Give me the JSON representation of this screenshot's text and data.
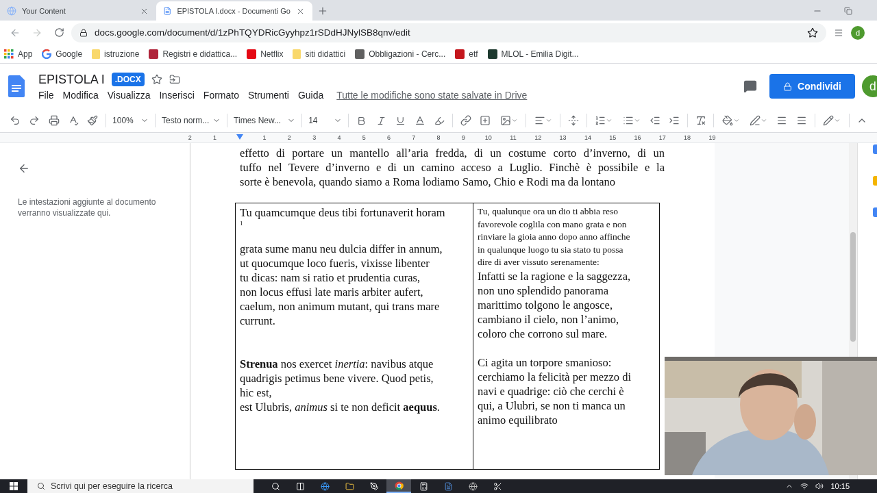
{
  "browser": {
    "tabs": [
      {
        "title": "Your Content",
        "selected": false
      },
      {
        "title": "EPISTOLA I.docx - Documenti Go",
        "selected": true
      }
    ],
    "url": "docs.google.com/document/d/1zPhTQYDRicGyyhpz1rSDdHJNylSB8qnv/edit",
    "profile": "d",
    "bookmarks": [
      {
        "label": "App",
        "kind": "apps"
      },
      {
        "label": "Google",
        "kind": "google"
      },
      {
        "label": "istruzione",
        "kind": "folder"
      },
      {
        "label": "Registri e didattica...",
        "kind": "site",
        "color": "#b0243a"
      },
      {
        "label": "Netflix",
        "kind": "site",
        "color": "#e50914"
      },
      {
        "label": "siti didattici",
        "kind": "folder"
      },
      {
        "label": "Obbligazioni - Cerc...",
        "kind": "site",
        "color": "#606060"
      },
      {
        "label": "etf",
        "kind": "site",
        "color": "#c4161c"
      },
      {
        "label": "MLOL - Emilia Digit...",
        "kind": "site",
        "color": "#1e3a2f"
      }
    ]
  },
  "docs": {
    "title": "EPISTOLA I",
    "badge": ".DOCX",
    "menu": [
      "File",
      "Modifica",
      "Visualizza",
      "Inserisci",
      "Formato",
      "Strumenti",
      "Guida"
    ],
    "save_status": "Tutte le modifiche sono state salvate in Drive",
    "share_button": "Condividi",
    "avatar": "d"
  },
  "toolbar": {
    "zoom": "100%",
    "style": "Testo norm...",
    "font": "Times New...",
    "size": "14"
  },
  "ruler": {
    "marks": [
      "2",
      "1",
      "1",
      "2",
      "3",
      "4",
      "5",
      "6",
      "7",
      "8",
      "9",
      "10",
      "11",
      "12",
      "13",
      "14",
      "15",
      "16",
      "17",
      "18",
      "19"
    ]
  },
  "outline": {
    "message": "Le intestazioni aggiunte al documento verranno visualizzate qui."
  },
  "document": {
    "paragraph_lines": [
      "effetto di portare un mantello all’aria fredda, di un costume corto d’inverno, di un",
      "tuffo nel Tevere d’inverno e di un camino acceso a Luglio. Finchè è possibile e la",
      "sorte è benevola, quando siamo a Roma lodiamo Samo, Chio e Rodi ma da lontano"
    ],
    "table": {
      "cells": [
        {
          "blocks": [
            {
              "kind": "normal",
              "lines": [
                "Tu quamcumque deus tibi fortunaverit horam"
              ]
            },
            {
              "kind": "note",
              "lines": [
                "1"
              ]
            },
            {
              "kind": "blank"
            },
            {
              "kind": "normal",
              "lines": [
                "grata sume manu neu dulcia differ in annum,",
                "ut quocumque loco fueris, vixisse libenter",
                "tu dicas: nam si ratio et prudentia curas,",
                "non locus effusi late maris arbiter aufert,",
                "caelum, non animum mutant, qui trans mare",
                "currunt."
              ]
            },
            {
              "kind": "blank"
            },
            {
              "kind": "blank"
            },
            {
              "kind": "normal",
              "lines": [
                "**Strenua** nos exercet *inertia*: navibus atque",
                "quadrigis petimus bene vivere. Quod petis,",
                "hic est,",
                "est Ulubris, *animus* si te non deficit **aequus**."
              ]
            }
          ]
        },
        {
          "blocks": [
            {
              "kind": "small",
              "lines": [
                "Tu, qualunque ora un dio ti abbia reso",
                "favorevole coglila con mano grata e non",
                "rinviare la gioia anno dopo anno affinche",
                "in qualunque luogo tu sia stato tu possa",
                "dire di aver vissuto serenamente:"
              ]
            },
            {
              "kind": "normal",
              "lines": [
                "Infatti se la ragione e la saggezza,",
                "non uno splendido panorama",
                "marittimo tolgono le angosce,",
                "cambiano il cielo, non l’animo,",
                "coloro che corrono sul mare."
              ]
            },
            {
              "kind": "blank"
            },
            {
              "kind": "normal",
              "lines": [
                "Ci agita un torpore smanioso:",
                "cerchiamo la felicità per mezzo di",
                "navi e quadrige: ciò che cerchi è",
                "qui, a Ulubri, se non ti manca un",
                "animo equilibrato"
              ]
            }
          ]
        }
      ]
    }
  },
  "taskbar": {
    "search_placeholder": "Scrivi qui per eseguire la ricerca",
    "clock": "10:15",
    "apps": [
      {
        "kind": "search",
        "selected": false
      },
      {
        "kind": "taskview",
        "selected": false
      },
      {
        "kind": "edge",
        "selected": false
      },
      {
        "kind": "folder",
        "selected": false
      },
      {
        "kind": "pen",
        "selected": false
      },
      {
        "kind": "chrome",
        "selected": true
      },
      {
        "kind": "calculator",
        "selected": false
      },
      {
        "kind": "word",
        "selected": false
      },
      {
        "kind": "app",
        "selected": false
      },
      {
        "kind": "snip",
        "selected": false
      }
    ]
  }
}
